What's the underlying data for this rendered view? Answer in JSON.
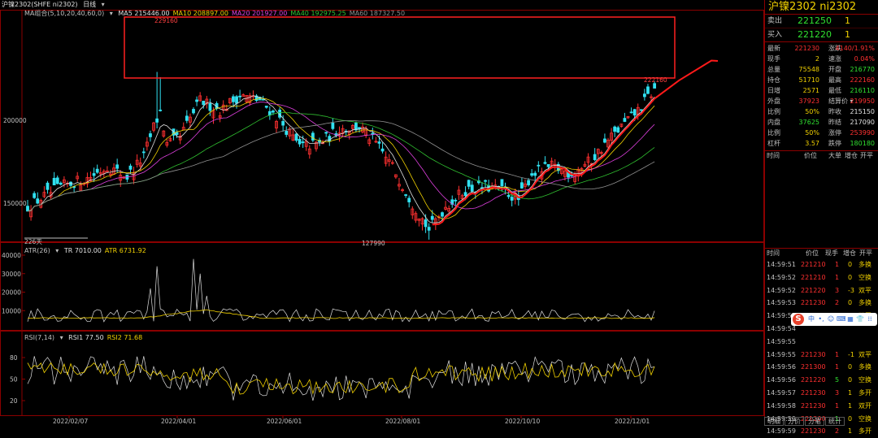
{
  "title_bar": {
    "symbol": "沪镍2302(SHFE ni2302)",
    "period": "日线",
    "dropdown": "▾"
  },
  "ma_legend": {
    "label": "MA组合(5,10,20,40,60,0)",
    "items": [
      {
        "text": "MA5 215446.00",
        "color": "#e0e0e0"
      },
      {
        "text": "MA10 208897.00",
        "color": "#f0d000"
      },
      {
        "text": "MA20 201927.00",
        "color": "#e040e0"
      },
      {
        "text": "MA40 192975.25",
        "color": "#30c030"
      },
      {
        "text": "MA60 187327.50",
        "color": "#909090"
      }
    ]
  },
  "atr_legend": {
    "label": "ATR(26)",
    "items": [
      {
        "text": "TR 7010.00",
        "color": "#e0e0e0"
      },
      {
        "text": "ATR 6731.92",
        "color": "#f0d000"
      }
    ]
  },
  "rsi_legend": {
    "label": "RSI(7,14)",
    "items": [
      {
        "text": "RSI1 77.50",
        "color": "#e0e0e0"
      },
      {
        "text": "RSI2 71.68",
        "color": "#f0d000"
      }
    ]
  },
  "chart_data": {
    "type": "candlestick",
    "price_axis_ticks": [
      "200000",
      "150000"
    ],
    "atr_axis_ticks": [
      "40000",
      "30000",
      "20000",
      "10000"
    ],
    "rsi_axis_ticks": [
      "80",
      "50",
      "20"
    ],
    "date_ticks": [
      "2022/02/07",
      "2022/04/01",
      "2022/06/01",
      "2022/08/01",
      "2022/10/10",
      "2022/12/01"
    ],
    "annotations": {
      "high": "229160",
      "low": "127990",
      "last_high": "222160",
      "days": "226天"
    },
    "colors": {
      "up": "#ff3030",
      "down": "#30e0f0",
      "ma5": "#e0e0e0",
      "ma10": "#f0d000",
      "ma20": "#e040e0",
      "ma40": "#30c030",
      "ma60": "#909090",
      "trend": "#ff1a1a",
      "highlight_box": "#ff2020"
    }
  },
  "right_panel": {
    "title": "沪镍2302 ni2302",
    "sell": {
      "label": "卖出",
      "price": "221250",
      "vol": "1"
    },
    "buy": {
      "label": "买入",
      "price": "221220",
      "vol": "1"
    },
    "quote_rows": [
      {
        "k1": "最新",
        "v1": "221230",
        "c1": "red",
        "k2": "涨跌",
        "v2": "4140/1.91%",
        "c2": "red"
      },
      {
        "k1": "现手",
        "v1": "2",
        "c1": "yellow",
        "k2": "速涨",
        "v2": "0.04%",
        "c2": "red"
      },
      {
        "k1": "总量",
        "v1": "75548",
        "c1": "yellow",
        "k2": "开盘",
        "v2": "216770",
        "c2": "green"
      },
      {
        "k1": "持仓",
        "v1": "51710",
        "c1": "yellow",
        "k2": "最高",
        "v2": "222160",
        "c2": "red"
      },
      {
        "k1": "日增",
        "v1": "2571",
        "c1": "yellow",
        "k2": "最低",
        "v2": "216110",
        "c2": "green"
      },
      {
        "k1": "外盘",
        "v1": "37923",
        "c1": "red",
        "k2": "结算价 ▾",
        "v2": "219950",
        "c2": "red"
      },
      {
        "k1": "比例",
        "v1": "50%",
        "c1": "yellow",
        "k2": "昨收",
        "v2": "215150",
        "c2": "white"
      },
      {
        "k1": "内盘",
        "v1": "37625",
        "c1": "green",
        "k2": "昨结",
        "v2": "217090",
        "c2": "white"
      },
      {
        "k1": "比例",
        "v1": "50%",
        "c1": "yellow",
        "k2": "涨停",
        "v2": "253990",
        "c2": "red"
      },
      {
        "k1": "杠杆",
        "v1": "3.57",
        "c1": "yellow",
        "k2": "跌停",
        "v2": "180180",
        "c2": "green"
      }
    ],
    "upper_head": {
      "time": "时间",
      "price": "价位",
      "big": "大单",
      "oi": "增仓",
      "open": "开平"
    },
    "tick_head": {
      "time": "时间",
      "price": "价位",
      "vol": "现手",
      "oi": "增仓",
      "type": "开平"
    },
    "ticks": [
      {
        "time": "14:59:51",
        "price": "221210",
        "vol": "1",
        "vc": "red",
        "oi": "0",
        "oc": "yellow",
        "type": "多换",
        "tc": "yellow"
      },
      {
        "time": "14:59:52",
        "price": "221210",
        "vol": "1",
        "vc": "red",
        "oi": "0",
        "oc": "yellow",
        "type": "空换",
        "tc": "yellow"
      },
      {
        "time": "14:59:52",
        "price": "221220",
        "vol": "3",
        "vc": "red",
        "oi": "-3",
        "oc": "yellow",
        "type": "双平",
        "tc": "yellow"
      },
      {
        "time": "14:59:53",
        "price": "221230",
        "vol": "2",
        "vc": "red",
        "oi": "0",
        "oc": "yellow",
        "type": "多换",
        "tc": "yellow"
      },
      {
        "time": "14:59:54",
        "price": "221240",
        "vol": "1",
        "vc": "red",
        "oi": "-1",
        "oc": "yellow",
        "type": "双平",
        "tc": "yellow"
      },
      {
        "time": "14:59:54",
        "price": "",
        "vol": "",
        "vc": "red",
        "oi": "",
        "oc": "yellow",
        "type": "",
        "tc": "yellow"
      },
      {
        "time": "14:59:55",
        "price": "",
        "vol": "",
        "vc": "red",
        "oi": "",
        "oc": "yellow",
        "type": "",
        "tc": "yellow"
      },
      {
        "time": "14:59:55",
        "price": "221230",
        "vol": "1",
        "vc": "red",
        "oi": "-1",
        "oc": "yellow",
        "type": "双平",
        "tc": "yellow"
      },
      {
        "time": "14:59:56",
        "price": "221300",
        "vol": "1",
        "vc": "red",
        "oi": "0",
        "oc": "yellow",
        "type": "多换",
        "tc": "yellow"
      },
      {
        "time": "14:59:56",
        "price": "221220",
        "vol": "5",
        "vc": "green",
        "oi": "0",
        "oc": "yellow",
        "type": "空换",
        "tc": "yellow"
      },
      {
        "time": "14:59:57",
        "price": "221230",
        "vol": "3",
        "vc": "red",
        "oi": "1",
        "oc": "yellow",
        "type": "多开",
        "tc": "yellow"
      },
      {
        "time": "14:59:58",
        "price": "221230",
        "vol": "1",
        "vc": "red",
        "oi": "1",
        "oc": "yellow",
        "type": "双开",
        "tc": "yellow"
      },
      {
        "time": "14:59:59",
        "price": "221200",
        "vol": "1",
        "vc": "green",
        "oi": "0",
        "oc": "yellow",
        "type": "空换",
        "tc": "yellow"
      },
      {
        "time": "14:59:59",
        "price": "221230",
        "vol": "2",
        "vc": "red",
        "oi": "1",
        "oc": "yellow",
        "type": "多开",
        "tc": "yellow"
      }
    ],
    "tabs": [
      "明细",
      "分价",
      "分笔",
      "统计"
    ]
  },
  "float_toolbar": {
    "logo": "S",
    "items": [
      "中",
      "•,",
      "☺",
      "⌨",
      "▦",
      "👕",
      "⁞⁞"
    ]
  }
}
